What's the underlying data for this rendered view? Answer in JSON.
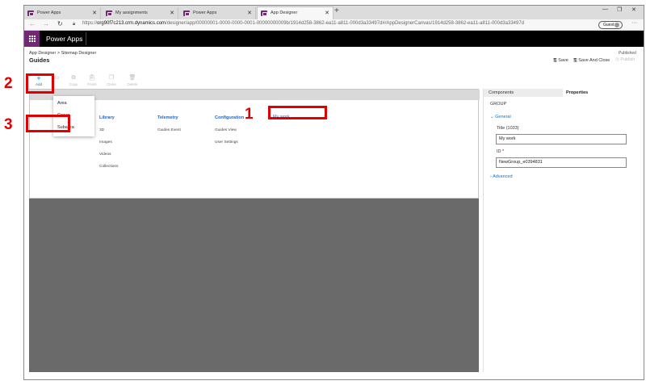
{
  "browser": {
    "tabs": [
      {
        "label": "Power Apps",
        "active": false
      },
      {
        "label": "My assignments",
        "active": false
      },
      {
        "label": "Power Apps",
        "active": false
      },
      {
        "label": "App Designer",
        "active": true
      }
    ],
    "new_tab_icon": "plus-icon",
    "url_prefix": "https://",
    "url_host": "org90f7c213.crm.dynamics.com",
    "url_path": "/designer/app/00000001-0000-0000-0001-00000000009b/1914d258-3862-ea11-a811-000d3a33497d#/AppDesignerCanvas/1914d258-3862-ea11-a811-000d3a33497d",
    "profile_label": "Guest"
  },
  "header": {
    "app_title": "Power Apps"
  },
  "designer": {
    "breadcrumb": [
      "App Designer",
      "Sitemap Designer"
    ],
    "breadcrumb_separator": ">",
    "page_title": "Guides",
    "status": "Published",
    "save_label": "Save",
    "save_close_label": "Save And Close",
    "publish_label": "Publish"
  },
  "toolbar": {
    "items": [
      {
        "label": "Add",
        "icon": "plus-icon",
        "enabled": true
      },
      {
        "label": "",
        "icon": "collapse-icon",
        "enabled": false
      },
      {
        "label": "Copy",
        "icon": "copy-icon",
        "enabled": false
      },
      {
        "label": "Paste",
        "icon": "paste-icon",
        "enabled": false
      },
      {
        "label": "Clone",
        "icon": "clone-icon",
        "enabled": false
      },
      {
        "label": "Delete",
        "icon": "delete-icon",
        "enabled": false
      }
    ]
  },
  "add_menu": {
    "items": [
      "Area",
      "Group",
      "Subarea"
    ]
  },
  "canvas": {
    "groups": [
      {
        "title": "Library",
        "subareas": [
          "3D",
          "Images",
          "Videos",
          "Collections"
        ]
      },
      {
        "title": "Telemetry",
        "subareas": [
          "Guides Event"
        ]
      },
      {
        "title": "Configuration",
        "subareas": [
          "Guides View",
          "User Settings"
        ]
      },
      {
        "title": "My work",
        "subareas": []
      }
    ]
  },
  "properties": {
    "tab_components": "Components",
    "tab_properties": "Properties",
    "section_type": "GROUP",
    "general_label": "General",
    "title_label": "Title (1033)",
    "title_value": "My work",
    "id_label": "ID",
    "id_required_marker": "*",
    "id_value": "NewGroup_e0394831",
    "advanced_label": "Advanced"
  },
  "annotations": {
    "step1": "1",
    "step2": "2",
    "step3": "3",
    "color": "#e00000"
  },
  "colors": {
    "brand": "#742774",
    "link": "#0078d4",
    "group_title": "#2563c9",
    "canvas_bg": "#6a6a6a"
  }
}
